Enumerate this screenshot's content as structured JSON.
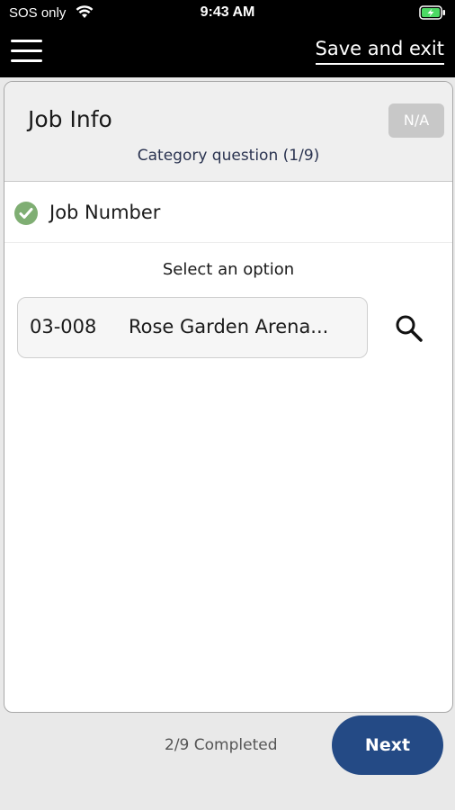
{
  "status_bar": {
    "carrier": "SOS only",
    "time": "9:43 AM",
    "icons": [
      "wifi-icon",
      "battery-charging-icon"
    ]
  },
  "app_bar": {
    "menu_icon": "hamburger-menu-icon",
    "save_exit_label": "Save and exit"
  },
  "card": {
    "title": "Job Info",
    "na_label": "N/A",
    "category_progress": "Category question (1/9)",
    "question": {
      "label": "Job Number",
      "status_icon": "check-circle-icon",
      "status_color": "#7fae73"
    },
    "select_prompt": "Select an option",
    "selection": {
      "code": "03-008",
      "name": "Rose Garden Arena..."
    },
    "search_icon": "search-icon"
  },
  "footer": {
    "completed_text": "2/9 Completed",
    "next_label": "Next",
    "accent_color": "#244a85"
  }
}
